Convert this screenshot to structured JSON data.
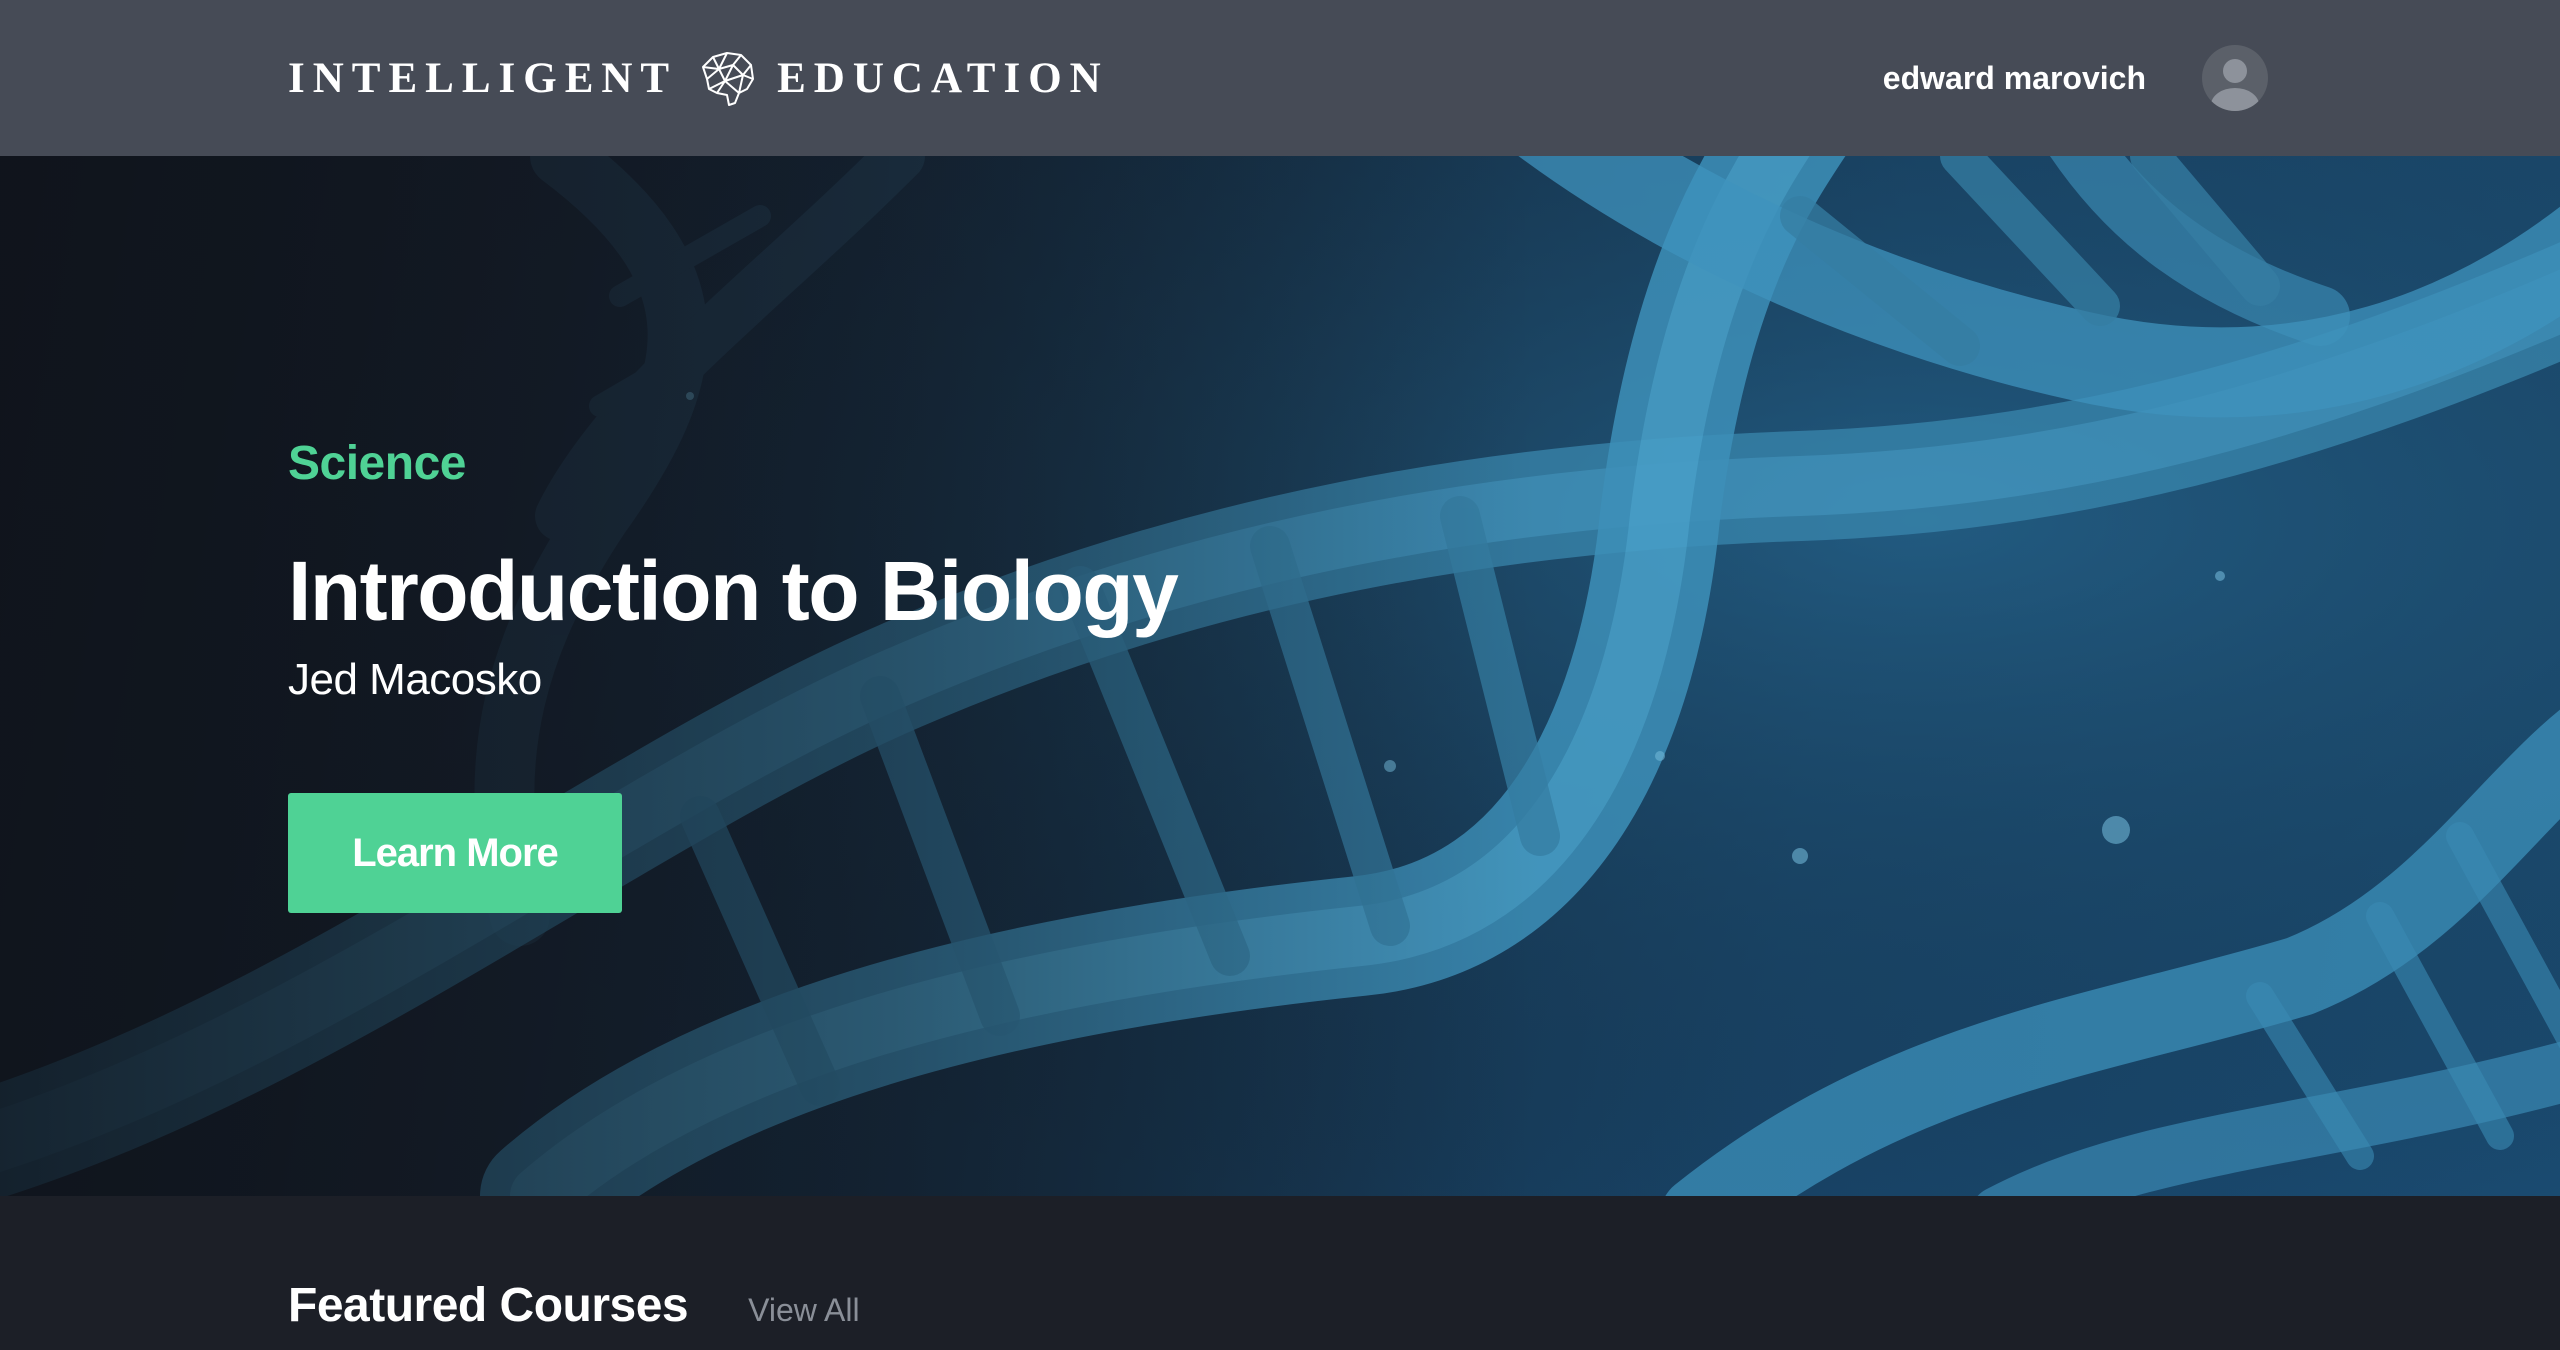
{
  "header": {
    "logo_left": "INTELLIGENT",
    "logo_right": "EDUCATION",
    "logo_icon": "brain-icon",
    "user_name": "edward marovich",
    "avatar_icon": "user-avatar-icon"
  },
  "hero": {
    "category": "Science",
    "title": "Introduction to Biology",
    "instructor": "Jed Macosko",
    "cta_label": "Learn More",
    "background": "dna-helix-image"
  },
  "featured": {
    "title": "Featured Courses",
    "view_all": "View All"
  },
  "colors": {
    "accent": "#4fd295",
    "header_bg": "#464b56",
    "page_bg": "#1c1f27",
    "dna_blue": "#3e9ac4"
  }
}
